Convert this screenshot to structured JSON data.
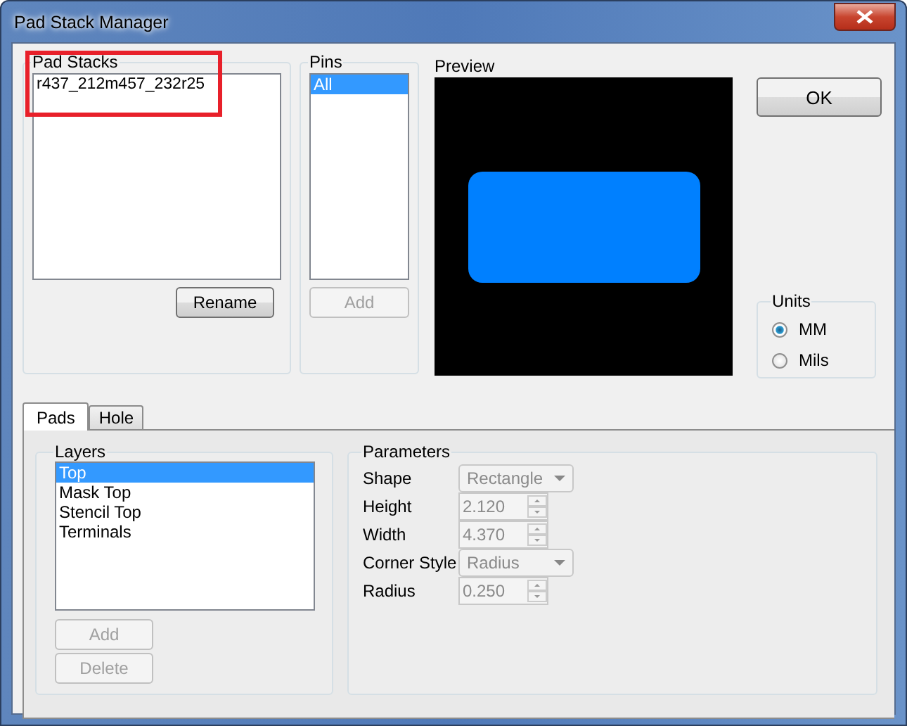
{
  "window": {
    "title": "Pad Stack Manager"
  },
  "pad_stacks": {
    "label": "Pad Stacks",
    "items": [
      {
        "text": "r437_212m457_232r25",
        "selected": false
      }
    ],
    "rename_button": {
      "label": "Rename",
      "disabled": false
    }
  },
  "pins": {
    "label": "Pins",
    "items": [
      {
        "text": "All",
        "selected": true
      }
    ],
    "add_button": {
      "label": "Add",
      "disabled": true
    }
  },
  "preview": {
    "label": "Preview"
  },
  "ok_button": {
    "label": "OK"
  },
  "units": {
    "label": "Units",
    "options": [
      {
        "label": "MM",
        "selected": true
      },
      {
        "label": "Mils",
        "selected": false
      }
    ]
  },
  "tabs": [
    {
      "label": "Pads",
      "selected": true
    },
    {
      "label": "Hole",
      "selected": false
    }
  ],
  "layers": {
    "label": "Layers",
    "items": [
      {
        "text": "Top",
        "selected": true
      },
      {
        "text": "Mask Top",
        "selected": false
      },
      {
        "text": "Stencil Top",
        "selected": false
      },
      {
        "text": "Terminals",
        "selected": false
      }
    ],
    "buttons": [
      {
        "label": "Add",
        "disabled": true
      },
      {
        "label": "Delete",
        "disabled": true
      }
    ]
  },
  "parameters": {
    "label": "Parameters",
    "fields": [
      {
        "label": "Shape",
        "kind": "dropdown",
        "value": "Rectangle",
        "disabled": true
      },
      {
        "label": "Height",
        "kind": "spinner",
        "value": "2.120",
        "disabled": true
      },
      {
        "label": "Width",
        "kind": "spinner",
        "value": "4.370",
        "disabled": true
      },
      {
        "label": "Corner Style",
        "kind": "dropdown",
        "value": "Radius",
        "disabled": true
      },
      {
        "label": "Radius",
        "kind": "spinner",
        "value": "0.250",
        "disabled": true
      }
    ]
  }
}
